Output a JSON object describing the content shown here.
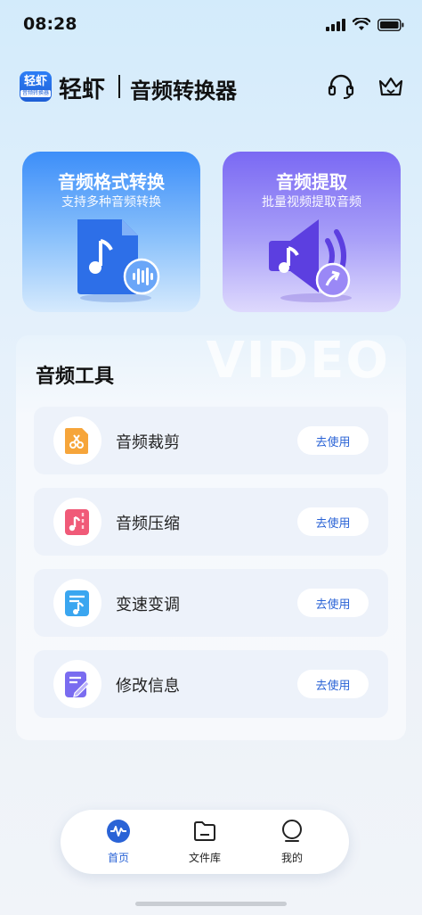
{
  "status": {
    "time": "08:28"
  },
  "header": {
    "logo": {
      "line1": "轻虾",
      "line2": "音频转换器"
    },
    "brand": "轻虾",
    "title": "音频转换器",
    "icons": [
      "headset-icon",
      "crown-icon"
    ]
  },
  "features": [
    {
      "title": "音频格式转换",
      "subtitle": "支持多种音频转换",
      "icon": "audio-file-icon",
      "color": "#3c8ef9"
    },
    {
      "title": "音频提取",
      "subtitle": "批量视频提取音频",
      "icon": "speaker-icon",
      "color": "#7a69f3"
    }
  ],
  "tools": {
    "watermark": "VIDEO",
    "title": "音频工具",
    "items": [
      {
        "label": "音频裁剪",
        "action": "去使用",
        "icon": "scissors-icon",
        "color": "#f6a53a"
      },
      {
        "label": "音频压缩",
        "action": "去使用",
        "icon": "compress-icon",
        "color": "#f05a78"
      },
      {
        "label": "变速变调",
        "action": "去使用",
        "icon": "speed-icon",
        "color": "#3aa6f0"
      },
      {
        "label": "修改信息",
        "action": "去使用",
        "icon": "edit-icon",
        "color": "#7a6cf0"
      }
    ]
  },
  "nav": {
    "items": [
      {
        "label": "首页",
        "icon": "home-wave-icon",
        "active": true
      },
      {
        "label": "文件库",
        "icon": "folder-icon",
        "active": false
      },
      {
        "label": "我的",
        "icon": "profile-icon",
        "active": false
      }
    ],
    "active_color": "#2a63d6"
  }
}
